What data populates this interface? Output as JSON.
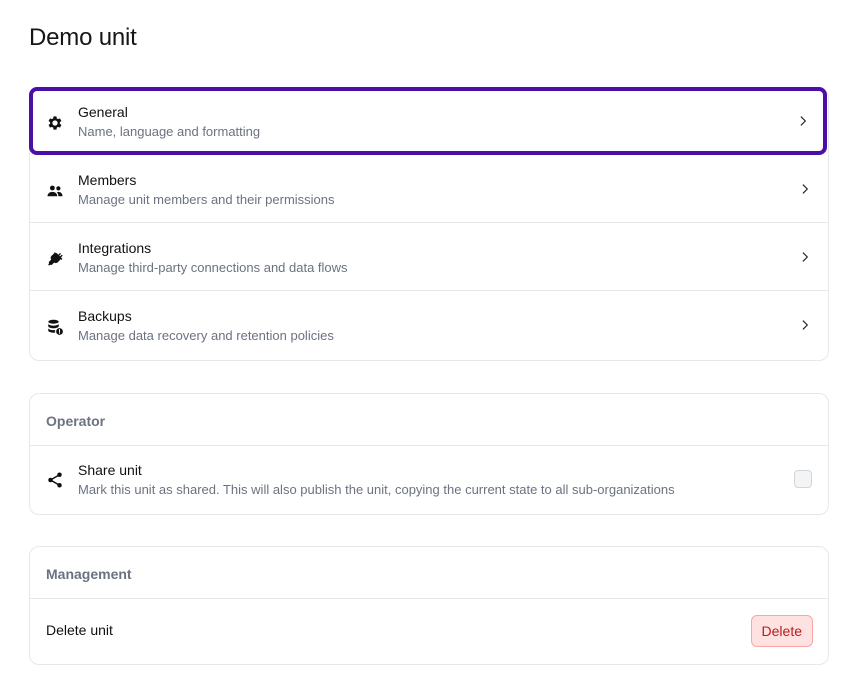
{
  "page": {
    "title": "Demo unit"
  },
  "settings": {
    "items": [
      {
        "title": "General",
        "description": "Name, language and formatting",
        "icon": "gear-icon"
      },
      {
        "title": "Members",
        "description": "Manage unit members and their permissions",
        "icon": "users-icon"
      },
      {
        "title": "Integrations",
        "description": "Manage third-party connections and data flows",
        "icon": "plug-icon"
      },
      {
        "title": "Backups",
        "description": "Manage data recovery and retention policies",
        "icon": "database-icon"
      }
    ]
  },
  "operator": {
    "title": "Operator",
    "share": {
      "title": "Share unit",
      "description": "Mark this unit as shared. This will also publish the unit, copying the current state to all sub-organizations",
      "checked": false,
      "icon": "share-icon"
    }
  },
  "management": {
    "title": "Management",
    "delete_label": "Delete unit",
    "delete_button": "Delete"
  },
  "colors": {
    "selection_border": "#4a0fa8",
    "delete_bg": "#fee2e2",
    "delete_text": "#b91c1c"
  }
}
